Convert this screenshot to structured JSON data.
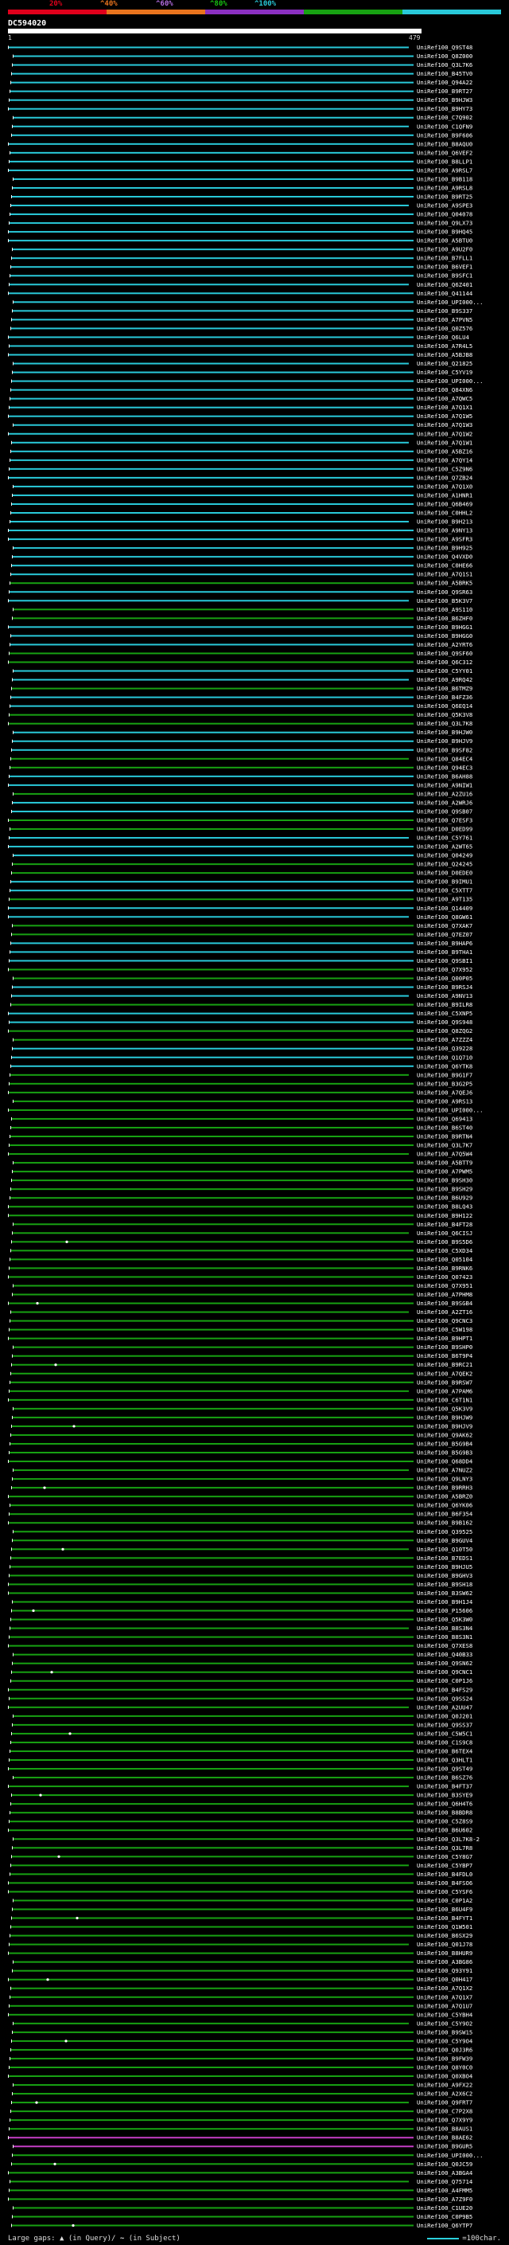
{
  "header": {
    "percent_labels": [
      "20%",
      "^40%",
      "^60%",
      "^80%",
      "^100%"
    ],
    "identity_colors": [
      "#e0001b",
      "#e8731d",
      "#8a2fc0",
      "#17a112",
      "#29c9d9"
    ],
    "query_id": "DC594020",
    "query_start": "1",
    "query_end": "479"
  },
  "hits": [
    "UniRef100_Q9ST48",
    "UniRef100_Q8Z000",
    "UniRef100_Q3L7K6",
    "UniRef100_B45TV0",
    "UniRef100_Q94A22",
    "UniRef100_B9RT27",
    "UniRef100_B9HJW3",
    "UniRef100_B9HY73",
    "UniRef100_C7Q902",
    "UniRef100_C1QFN9",
    "UniRef100_B9F606",
    "UniRef100_B8AQU0",
    "UniRef100_Q6VEF2",
    "UniRef100_B8LLP1",
    "UniRef100_A9RSL7",
    "UniRef100_B9B118",
    "UniRef100_A9RSL8",
    "UniRef100_B9RT25",
    "UniRef100_A9SPE3",
    "UniRef100_Q04078",
    "UniRef100_Q9LX73",
    "UniRef100_B9HQ45",
    "UniRef100_A5BTU0",
    "UniRef100_A9U2F0",
    "UniRef100_B7FLL1",
    "UniRef100_B6VEF1",
    "UniRef100_B9SFC1",
    "UniRef100_Q6Z401",
    "UniRef100_Q41144",
    "UniRef100_UPI000...",
    "UniRef100_B9S337",
    "UniRef100_A7PVN5",
    "UniRef100_Q0Z576",
    "UniRef100_Q6LU4",
    "UniRef100_A7R4L5",
    "UniRef100_A5BJB8",
    "UniRef100_Q21825",
    "UniRef100_C5YV19",
    "UniRef100_UPI000...",
    "UniRef100_Q84XN6",
    "UniRef100_A7QWC5",
    "UniRef100_A7Q1X1",
    "UniRef100_A7Q1W5",
    "UniRef100_A7Q1W3",
    "UniRef100_A7Q1W2",
    "UniRef100_A7Q1W1",
    "UniRef100_A5BZ16",
    "UniRef100_A7QY14",
    "UniRef100_C5Z9N6",
    "UniRef100_Q7ZB24",
    "UniRef100_A7Q1X0",
    "UniRef100_A1HNR1",
    "UniRef100_Q6B469",
    "UniRef100_C0HHL2",
    "UniRef100_B9H213",
    "UniRef100_A9NY13",
    "UniRef100_A9SFR3",
    "UniRef100_B9H925",
    "UniRef100_Q4VXD0",
    "UniRef100_C0HE66",
    "UniRef100_A7Q1S1",
    "UniRef100_A5BRK5",
    "UniRef100_Q9SR63",
    "UniRef100_B5K3V7",
    "UniRef100_A9S110",
    "UniRef100_B6ZHF0",
    "UniRef100_B9HGG1",
    "UniRef100_B9HGG0",
    "UniRef100_A2YRT6",
    "UniRef100_Q9SF60",
    "UniRef100_Q6C312",
    "UniRef100_C5YY01",
    "UniRef100_A9RQ42",
    "UniRef100_B6TMZ9",
    "UniRef100_B4FZ36",
    "UniRef100_Q6EQ14",
    "UniRef100_Q5K3V8",
    "UniRef100_Q3L7K8",
    "UniRef100_B9HJW0",
    "UniRef100_B9HJV9",
    "UniRef100_B9SF82",
    "UniRef100_Q84EC4",
    "UniRef100_Q94EC3",
    "UniRef100_B6AH88",
    "UniRef100_A9NIW1",
    "UniRef100_A2ZU16",
    "UniRef100_A2WRJ6",
    "UniRef100_Q9SB07",
    "UniRef100_Q7ESF3",
    "UniRef100_D0ED99",
    "UniRef100_C5Y761",
    "UniRef100_A2WT65",
    "UniRef100_Q04249",
    "UniRef100_Q24245",
    "UniRef100_D0EDE0",
    "UniRef100_B9IMU1",
    "UniRef100_C5XTT7",
    "UniRef100_A9T135",
    "UniRef100_Q14409",
    "UniRef100_Q8GW61",
    "UniRef100_Q7XAK7",
    "UniRef100_Q7EZ07",
    "UniRef100_B9HAP6",
    "UniRef100_B9THA1",
    "UniRef100_Q9SBI1",
    "UniRef100_Q7X952",
    "UniRef100_Q00P05",
    "UniRef100_B9RSJ4",
    "UniRef100_A9NV13",
    "UniRef100_B9ILR8",
    "UniRef100_C5XNP5",
    "UniRef100_Q9S948",
    "UniRef100_Q8ZQG2",
    "UniRef100_A7ZZZ4",
    "UniRef100_Q39228",
    "UniRef100_Q1Q710",
    "UniRef100_Q6YTK8",
    "UniRef100_B9G1F7",
    "UniRef100_B3G2P5",
    "UniRef100_A7QEJ6",
    "UniRef100_A9RS13",
    "UniRef100_UPI000...",
    "UniRef100_Q69413",
    "UniRef100_B6ST40",
    "UniRef100_B9RTN4",
    "UniRef100_Q3L7K7",
    "UniRef100_A7Q5W4",
    "UniRef100_A5BTT9",
    "UniRef100_A7PWM5",
    "UniRef100_B9SH30",
    "UniRef100_B9SH29",
    "UniRef100_B6U929",
    "UniRef100_B8LQ43",
    "UniRef100_B9H122",
    "UniRef100_B4FT28",
    "UniRef100_Q6CISJ",
    "UniRef100_B9S5D6",
    "UniRef100_C5XD34",
    "UniRef100_Q05104",
    "UniRef100_B9RNK6",
    "UniRef100_Q07423",
    "UniRef100_Q7X951",
    "UniRef100_A7PHM8",
    "UniRef100_B9SGB4",
    "UniRef100_A2ZT16",
    "UniRef100_Q9CNC3",
    "UniRef100_C5W198",
    "UniRef100_B9HPT1",
    "UniRef100_B9SHP0",
    "UniRef100_B6T9P4",
    "UniRef100_B9RC21",
    "UniRef100_A7QEK2",
    "UniRef100_B9RSW7",
    "UniRef100_A7PAM6",
    "UniRef100_C6T1N1",
    "UniRef100_Q5K3V9",
    "UniRef100_B9HJW9",
    "UniRef100_B9HJV9",
    "UniRef100_Q9AK62",
    "UniRef100_B5G9B4",
    "UniRef100_B5G9B3",
    "UniRef100_Q68DD4",
    "UniRef100_A7NUZ2",
    "UniRef100_Q9LNY3",
    "UniRef100_B9RRH3",
    "UniRef100_A5BRZ0",
    "UniRef100_Q6YK06",
    "UniRef100_B6F354",
    "UniRef100_B9B162",
    "UniRef100_Q39525",
    "UniRef100_B9GUV4",
    "UniRef100_Q10T50",
    "UniRef100_B7EDS1",
    "UniRef100_B9HJU5",
    "UniRef100_B9GHV3",
    "UniRef100_B9SH18",
    "UniRef100_B3SW62",
    "UniRef100_B9H1J4",
    "UniRef100_P15606",
    "UniRef100_Q5K3W0",
    "UniRef100_B8S3N4",
    "UniRef100_B8S3N1",
    "UniRef100_Q7XES8",
    "UniRef100_Q40B33",
    "UniRef100_Q9SN62",
    "UniRef100_Q9CNC1",
    "UniRef100_C0P1J6",
    "UniRef100_B4FS29",
    "UniRef100_Q9SS24",
    "UniRef100_A2UU47",
    "UniRef100_Q0J201",
    "UniRef100_Q9SS37",
    "UniRef100_C5W5C1",
    "UniRef100_C1S9C8",
    "UniRef100_B6TEX4",
    "UniRef100_Q3HLT1",
    "UniRef100_Q9ST49",
    "UniRef100_B6SZ76",
    "UniRef100_B4FT37",
    "UniRef100_B3SYE9",
    "UniRef100_Q6H4T6",
    "UniRef100_B8BDR8",
    "UniRef100_C5Z8S9",
    "UniRef100_B6U602",
    "UniRef100_Q3L7K8-2",
    "UniRef100_Q3L7R8",
    "UniRef100_C5Y8G7",
    "UniRef100_C5YBP7",
    "UniRef100_B4FDL0",
    "UniRef100_B4FSO6",
    "UniRef100_C5YSF6",
    "UniRef100_C0P1A2",
    "UniRef100_B6U4F9",
    "UniRef100_B4FYT1",
    "UniRef100_Q1W501",
    "UniRef100_B6SX29",
    "UniRef100_Q01J78",
    "UniRef100_B8HUR9",
    "UniRef100_A3BG86",
    "UniRef100_Q93Y91",
    "UniRef100_Q0H417",
    "UniRef100_A7Q1X2",
    "UniRef100_A7Q1X7",
    "UniRef100_A7Q1U7",
    "UniRef100_C5YBH4",
    "UniRef100_C5Y9O2",
    "UniRef100_B9SW15",
    "UniRef100_C5Y9O4",
    "UniRef100_Q0J3R6",
    "UniRef100_B9FW39",
    "UniRef100_Q8Y0C0",
    "UniRef100_Q0XBO4",
    "UniRef100_A9FX22",
    "UniRef100_A2X6C2",
    "UniRef100_Q9FRT7",
    "UniRef100_C7P2X8",
    "UniRef100_Q7X9Y9",
    "UniRef100_B8AUS1",
    "UniRef100_B8AE62",
    "UniRef100_B9GUR5",
    "UniRef100_UPI000...",
    "UniRef100_Q0JC59",
    "UniRef100_A3BGA4",
    "UniRef100_Q75714",
    "UniRef100_A4FMM5",
    "UniRef100_A7Z9F0",
    "UniRef100_C1UE20",
    "UniRef100_C0P9B5",
    "UniRef100_Q6YTP7"
  ],
  "hit_colors": {
    "blue": "#29c9d9",
    "green": "#17a112",
    "magenta": "#c43ec4"
  },
  "legend": {
    "large_gaps_label": "Large gaps:",
    "in_query_text": "(in Query)/",
    "in_subject_text": "(in Subject)",
    "scale_text": "=100char."
  }
}
